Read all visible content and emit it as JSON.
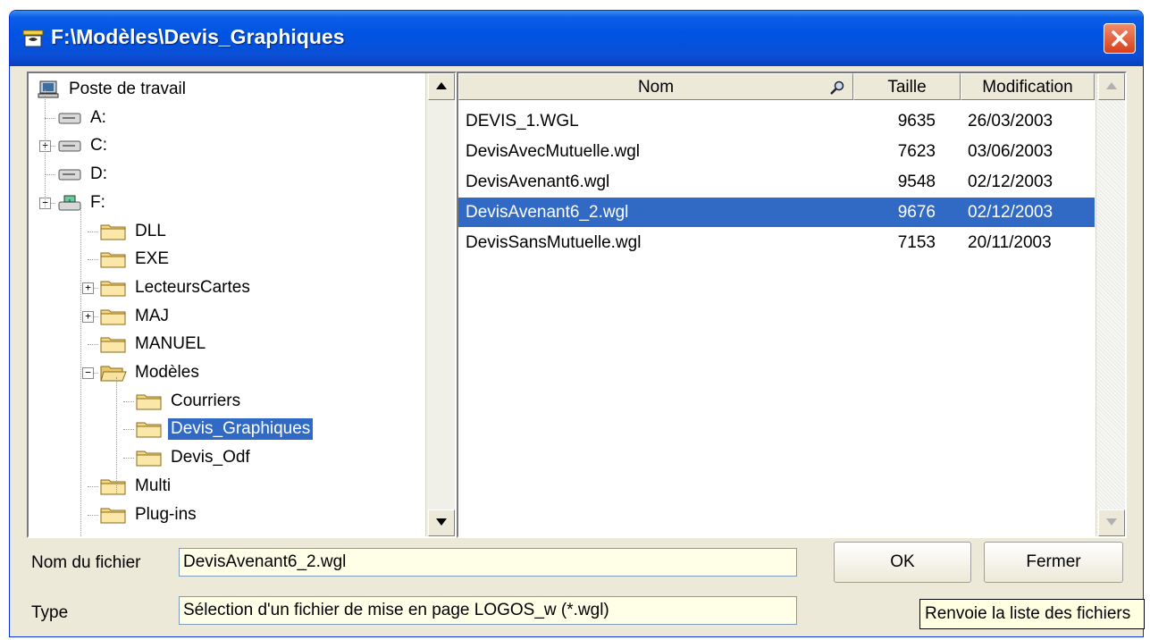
{
  "window": {
    "title": "F:\\Modèles\\Devis_Graphiques"
  },
  "tree": {
    "items": [
      {
        "label": "Poste de travail",
        "type": "computer"
      },
      {
        "label": "A:",
        "type": "drive"
      },
      {
        "label": "C:",
        "type": "drive",
        "expander": "+"
      },
      {
        "label": "D:",
        "type": "drive"
      },
      {
        "label": "F:",
        "type": "netdrive",
        "expander": "-"
      },
      {
        "label": "DLL",
        "type": "folder"
      },
      {
        "label": "EXE",
        "type": "folder"
      },
      {
        "label": "LecteursCartes",
        "type": "folder",
        "expander": "+"
      },
      {
        "label": "MAJ",
        "type": "folder",
        "expander": "+"
      },
      {
        "label": "MANUEL",
        "type": "folder"
      },
      {
        "label": "Modèles",
        "type": "folder-open",
        "expander": "-"
      },
      {
        "label": "Courriers",
        "type": "folder"
      },
      {
        "label": "Devis_Graphiques",
        "type": "folder",
        "selected": true
      },
      {
        "label": "Devis_Odf",
        "type": "folder"
      },
      {
        "label": "Multi",
        "type": "folder"
      },
      {
        "label": "Plug-ins",
        "type": "folder"
      }
    ]
  },
  "list": {
    "columns": {
      "name": "Nom",
      "size": "Taille",
      "modified": "Modification"
    },
    "rows": [
      {
        "name": "DEVIS_1.WGL",
        "size": "9635",
        "date": "26/03/2003"
      },
      {
        "name": "DevisAvecMutuelle.wgl",
        "size": "7623",
        "date": "03/06/2003"
      },
      {
        "name": "DevisAvenant6.wgl",
        "size": "9548",
        "date": "02/12/2003"
      },
      {
        "name": "DevisAvenant6_2.wgl",
        "size": "9676",
        "date": "02/12/2003",
        "selected": true
      },
      {
        "name": "DevisSansMutuelle.wgl",
        "size": "7153",
        "date": "20/11/2003"
      }
    ]
  },
  "form": {
    "filename_label": "Nom du fichier",
    "filename_value": "DevisAvenant6_2.wgl",
    "type_label": "Type",
    "type_value": "Sélection d'un fichier de mise en page LOGOS_w (*.wgl)"
  },
  "buttons": {
    "ok": "OK",
    "close": "Fermer"
  },
  "tooltip": "Renvoie la liste des fichiers",
  "colors": {
    "titlebar": "#0054e3",
    "selection": "#316ac5",
    "dialog_bg": "#ece9d8",
    "field_bg": "#ffffe8"
  }
}
